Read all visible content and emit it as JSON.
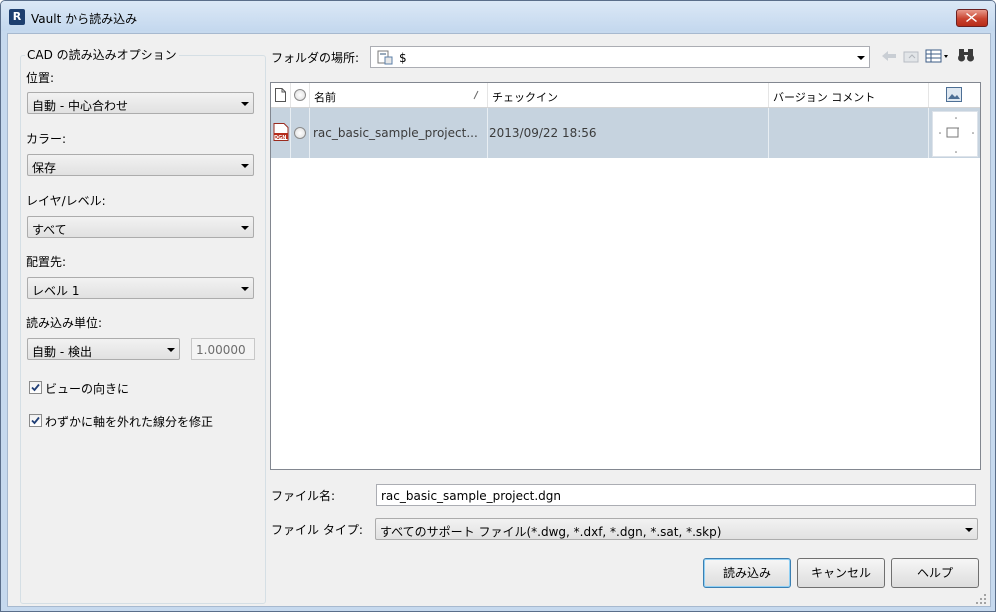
{
  "window": {
    "title": "Vault から読み込み",
    "app_icon_letter": "R",
    "accent_color": "#c6d9ee",
    "close_color": "#c9432f"
  },
  "options": {
    "group_title": "CAD の読み込みオプション",
    "position_label": "位置:",
    "position_value": "自動 - 中心合わせ",
    "color_label": "カラー:",
    "color_value": "保存",
    "layer_label": "レイヤ/レベル:",
    "layer_value": "すべて",
    "placement_label": "配置先:",
    "placement_value": "レベル 1",
    "units_label": "読み込み単位:",
    "units_value": "自動 - 検出",
    "scale_value": "1.00000",
    "orient_label": "ビューの向きに",
    "orient_checked": true,
    "fix_lines_label": "わずかに軸を外れた線分を修正",
    "fix_lines_checked": true
  },
  "folder": {
    "label": "フォルダの場所:",
    "value": "$"
  },
  "toolbar_icons": [
    "back-arrow-icon",
    "up-folder-icon",
    "view-menu-icon",
    "search-binoculars-icon"
  ],
  "file_list": {
    "columns": [
      "名前",
      "チェックイン",
      "バージョン コメント"
    ],
    "rows": [
      {
        "name": "rac_basic_sample_project...",
        "checkin": "2013/09/22 18:56",
        "comment": "",
        "file_icon_label": "DGN",
        "selected": true
      }
    ]
  },
  "file_name": {
    "label": "ファイル名:",
    "value": "rac_basic_sample_project.dgn"
  },
  "file_type": {
    "label": "ファイル タイプ:",
    "value": "すべてのサポート ファイル(*.dwg, *.dxf, *.dgn, *.sat, *.skp)"
  },
  "buttons": {
    "open": "読み込み",
    "cancel": "キャンセル",
    "help": "ヘルプ"
  }
}
